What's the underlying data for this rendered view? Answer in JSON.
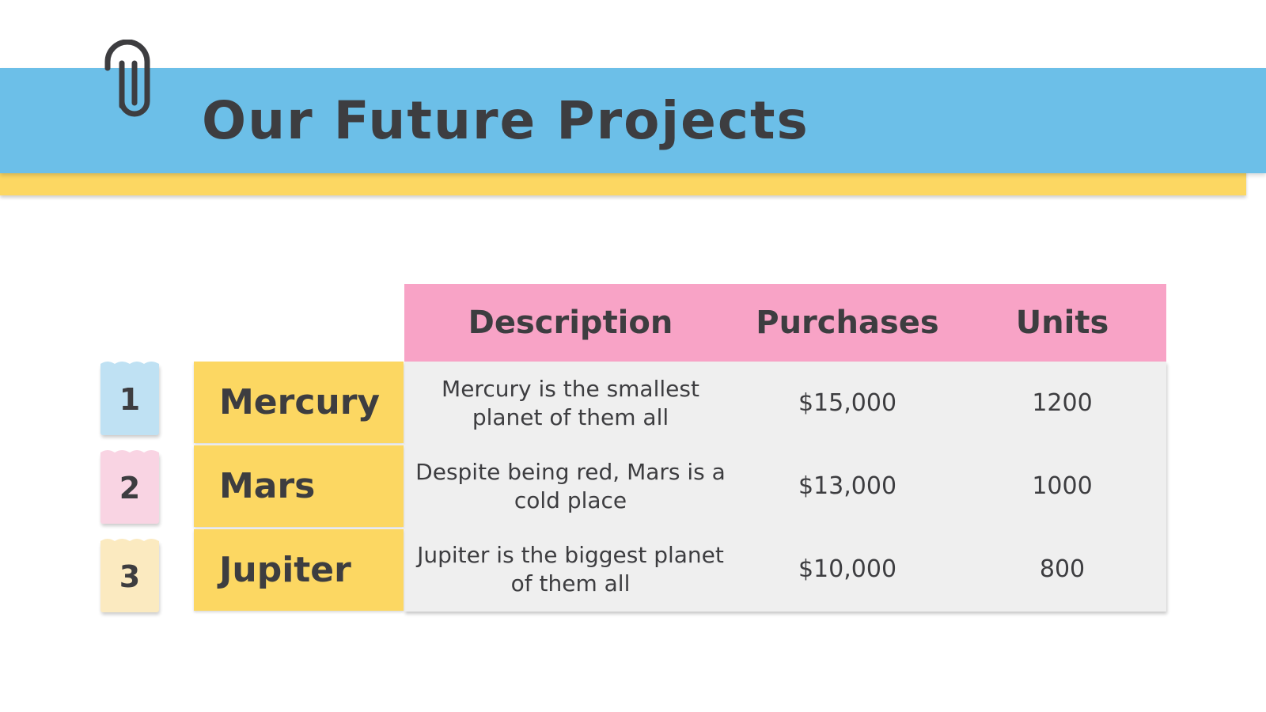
{
  "slide": {
    "title": "Our Future Projects"
  },
  "table": {
    "headers": {
      "description": "Description",
      "purchases": "Purchases",
      "units": "Units"
    },
    "rows": [
      {
        "number": "1",
        "name": "Mercury",
        "description": "Mercury is the smallest planet of them all",
        "purchases": "$15,000",
        "units": "1200"
      },
      {
        "number": "2",
        "name": "Mars",
        "description": "Despite being red, Mars is a cold place",
        "purchases": "$13,000",
        "units": "1000"
      },
      {
        "number": "3",
        "name": "Jupiter",
        "description": "Jupiter is the biggest planet of them all",
        "purchases": "$10,000",
        "units": "800"
      }
    ]
  },
  "colors": {
    "title_band": "#6cbfe8",
    "title_shadow_band": "#fcd762",
    "header_row": "#f8a3c6",
    "name_column": "#fcd762",
    "body_rows": "#efefef",
    "tag_1": "#bfe1f3",
    "tag_2": "#f9d4e3",
    "tag_3": "#fbeac0",
    "text": "#3d3d40"
  },
  "icons": {
    "title_decoration": "paperclip-icon"
  }
}
